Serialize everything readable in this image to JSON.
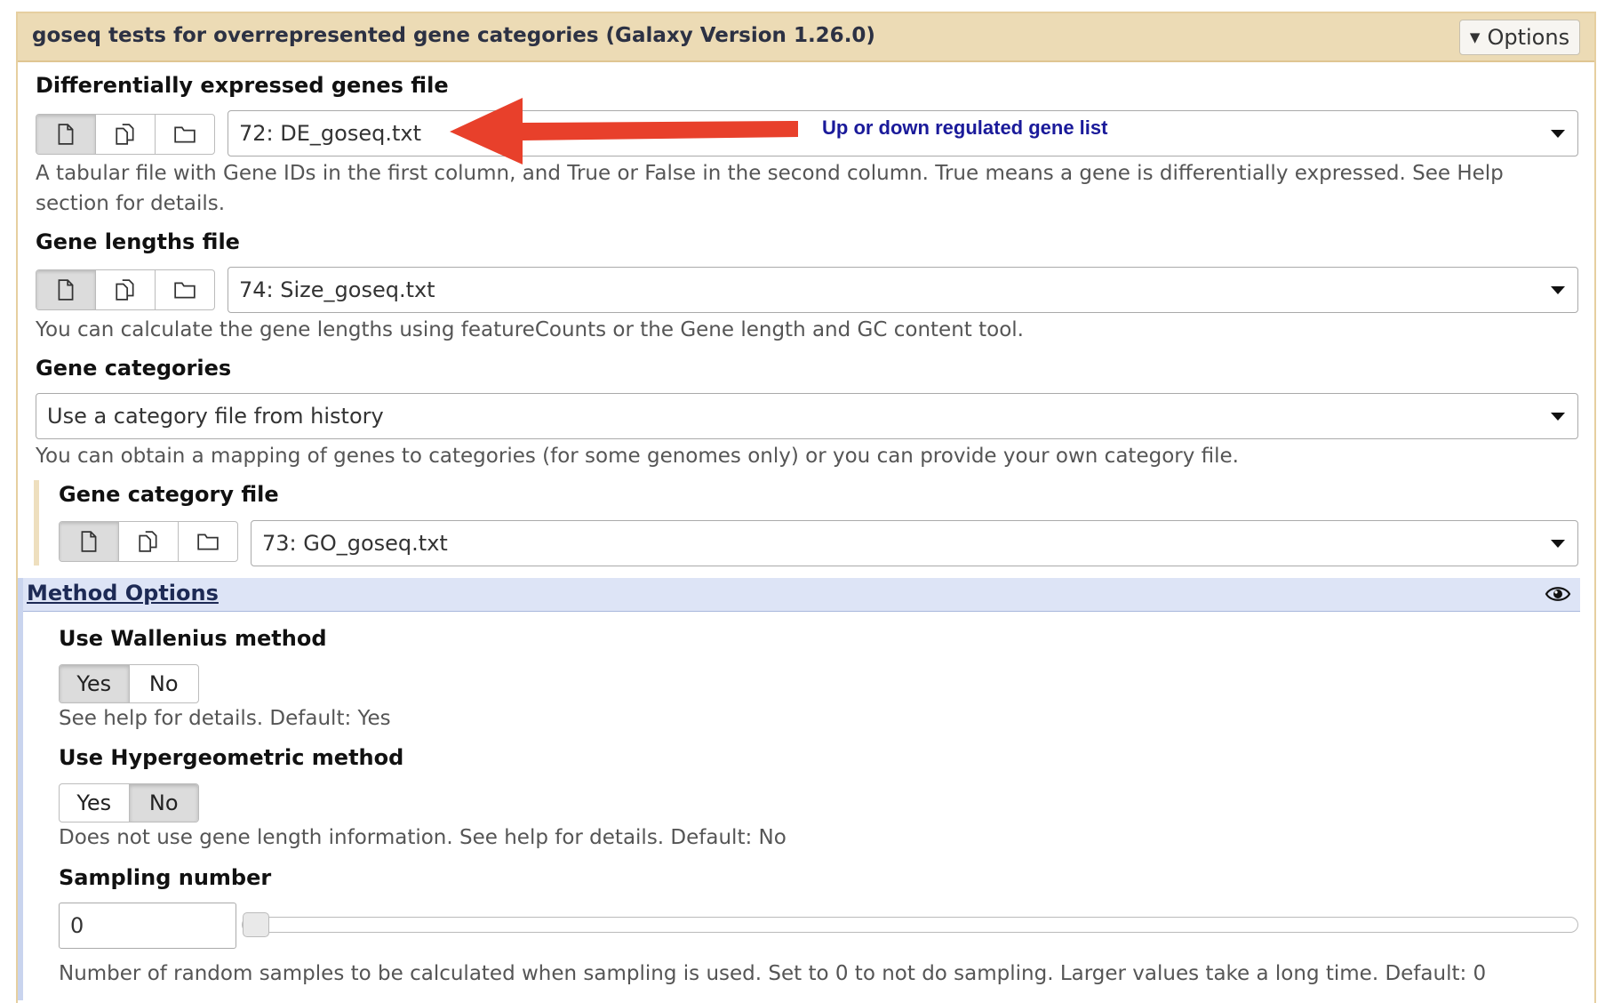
{
  "header": {
    "title": "goseq tests for overrepresented gene categories (Galaxy Version 1.26.0)",
    "options_label": "Options"
  },
  "de_genes": {
    "label": "Differentially expressed genes file",
    "selected": "72: DE_goseq.txt",
    "help": "A tabular file with Gene IDs in the first column, and True or False in the second column. True means a gene is differentially expressed. See Help section for details."
  },
  "annotation": {
    "text": "Up or down regulated gene list",
    "color": "#e8402b"
  },
  "gene_lengths": {
    "label": "Gene lengths file",
    "selected": "74: Size_goseq.txt",
    "help": "You can calculate the gene lengths using featureCounts or the Gene length and GC content tool."
  },
  "gene_categories": {
    "label": "Gene categories",
    "selected": "Use a category file from history",
    "help": "You can obtain a mapping of genes to categories (for some genomes only) or you can provide your own category file."
  },
  "gene_category_file": {
    "label": "Gene category file",
    "selected": "73: GO_goseq.txt"
  },
  "method_options": {
    "title": "Method Options",
    "wallenius": {
      "label": "Use Wallenius method",
      "yes": "Yes",
      "no": "No",
      "selected": "Yes",
      "help": "See help for details. Default: Yes"
    },
    "hypergeometric": {
      "label": "Use Hypergeometric method",
      "yes": "Yes",
      "no": "No",
      "selected": "No",
      "help": "Does not use gene length information. See help for details. Default: No"
    },
    "sampling": {
      "label": "Sampling number",
      "value": "0",
      "help": "Number of random samples to be calculated when sampling is used. Set to 0 to not do sampling. Larger values take a long time. Default: 0"
    }
  },
  "icons": {
    "single_dataset": "file-icon",
    "multiple_datasets": "files-icon",
    "collection": "folder-icon",
    "visibility": "eye-icon",
    "dropdown": "caret-down-icon"
  },
  "colors": {
    "header_bg": "#ecdbb5",
    "section_bg": "#dde4f6",
    "annotation_text": "#1a1a9a"
  }
}
